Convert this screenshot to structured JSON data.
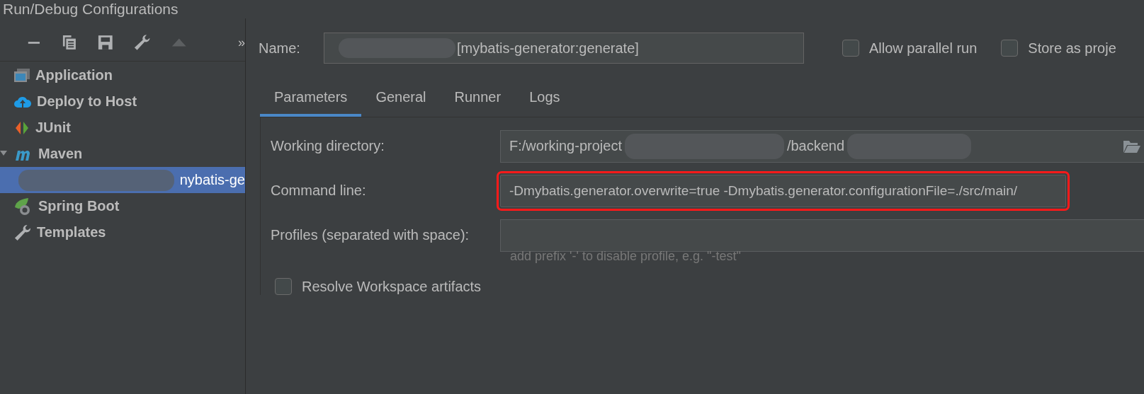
{
  "window": {
    "title": "Run/Debug Configurations"
  },
  "toolbar": {
    "overflow": "»"
  },
  "tree": [
    {
      "label": "Application",
      "kind": "application",
      "selected": false
    },
    {
      "label": "Deploy to Host",
      "kind": "cloud",
      "selected": false
    },
    {
      "label": "JUnit",
      "kind": "junit",
      "selected": false
    },
    {
      "label": "Maven",
      "kind": "maven",
      "selected": false,
      "expanded": true,
      "children": [
        {
          "label": "nybatis-ge",
          "selected": true
        }
      ]
    },
    {
      "label": "Spring Boot",
      "kind": "spring",
      "selected": false
    },
    {
      "label": "Templates",
      "kind": "wrench",
      "selected": false
    }
  ],
  "name_field": {
    "label": "Name:",
    "value": "[mybatis-generator:generate]"
  },
  "options": [
    {
      "label": "Allow parallel run",
      "checked": false
    },
    {
      "label": "Store as proje",
      "checked": false
    }
  ],
  "tabs": [
    {
      "label": "Parameters",
      "selected": true
    },
    {
      "label": "General",
      "selected": false
    },
    {
      "label": "Runner",
      "selected": false
    },
    {
      "label": "Logs",
      "selected": false
    }
  ],
  "form": [
    {
      "kind": "dir",
      "label": "Working directory:",
      "value": "F:/working-project",
      "value_2": "/backend"
    },
    {
      "kind": "text",
      "label": "Command line:",
      "value": "-Dmybatis.generator.overwrite=true -Dmybatis.generator.configurationFile=./src/main/",
      "highlighted": true
    },
    {
      "kind": "text",
      "label": "Profiles (separated with space):",
      "hint": "add prefix '-' to disable profile, e.g. \"-test\"",
      "highlighted": false
    }
  ],
  "resolve": {
    "label": "Resolve Workspace artifacts",
    "checked": false
  }
}
